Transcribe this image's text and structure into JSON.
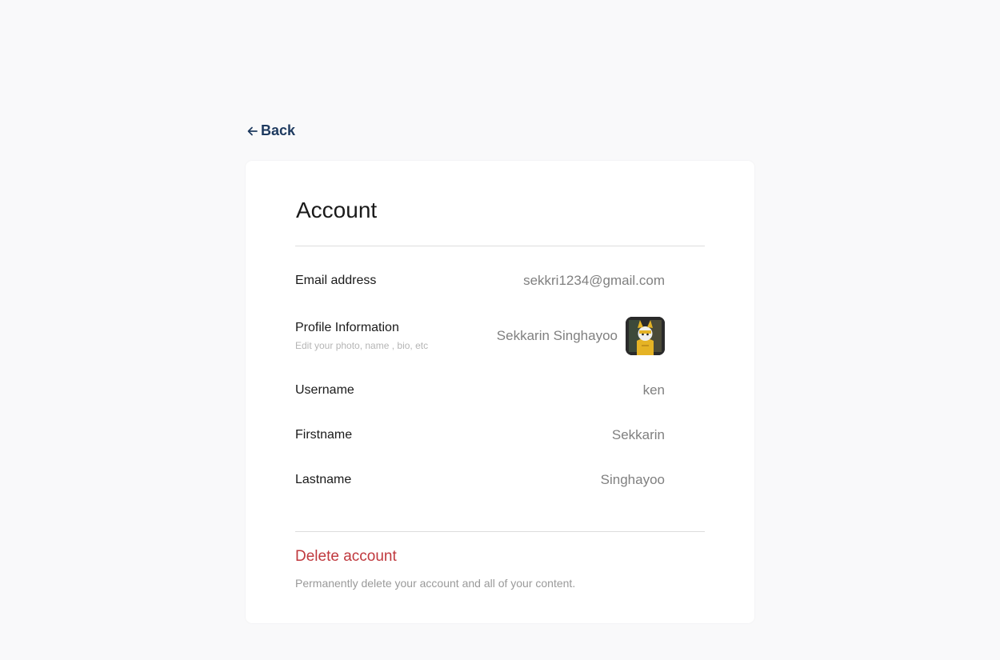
{
  "nav": {
    "back_label": "Back"
  },
  "account": {
    "title": "Account",
    "email": {
      "label": "Email address",
      "value": "sekkri1234@gmail.com"
    },
    "profile": {
      "label": "Profile Information",
      "sublabel": "Edit your photo, name , bio, etc",
      "display_name": "Sekkarin Singhayoo",
      "avatar_icon": "user-avatar"
    },
    "username": {
      "label": "Username",
      "value": "ken"
    },
    "firstname": {
      "label": "Firstname",
      "value": "Sekkarin"
    },
    "lastname": {
      "label": "Lastname",
      "value": "Singhayoo"
    }
  },
  "danger": {
    "delete_label": "Delete account",
    "delete_description": "Permanently delete your account and all of your content."
  },
  "colors": {
    "background": "#f9f9fa",
    "card": "#ffffff",
    "back_link": "#1e3a5f",
    "danger": "#c0393e",
    "muted_value": "#808080"
  }
}
